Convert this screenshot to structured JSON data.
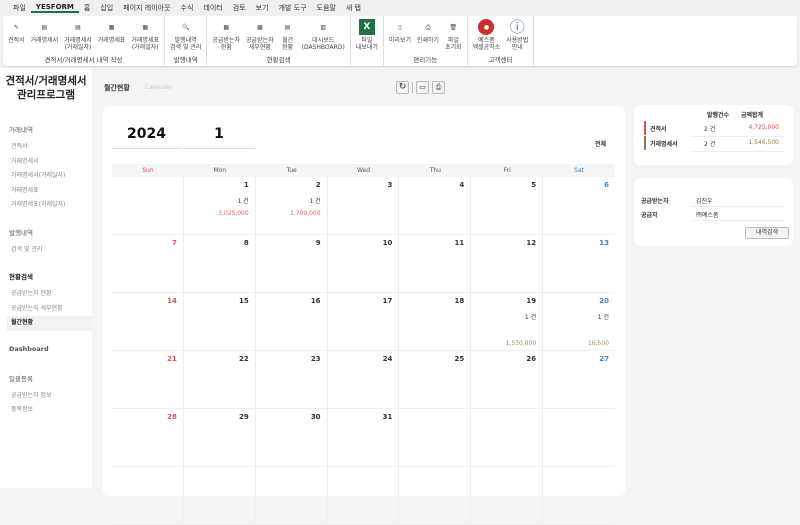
{
  "menu": [
    "파일",
    "YESFORM",
    "홈",
    "삽입",
    "페이지 레이아웃",
    "수식",
    "데이터",
    "검토",
    "보기",
    "개발 도구",
    "도움말",
    "새 탭"
  ],
  "ribbon": {
    "groups": [
      {
        "label": "견적서/거래명세서 내역 작성",
        "buttons": [
          "견적서",
          "거래명세서",
          "거래명세서\n(거래일자)",
          "거래명세표",
          "거래명세표\n(거래일자)"
        ]
      },
      {
        "label": "발행내역",
        "buttons": [
          "발행내역\n검색 및 관리"
        ]
      },
      {
        "label": "현황검색",
        "buttons": [
          "공급받는자\n현황",
          "공급받는자\n세부현황",
          "월간\n현황",
          "대시보드\n(DASHBOARD)"
        ]
      },
      {
        "label": "",
        "buttons": [
          "파일\n내보내기"
        ]
      },
      {
        "label": "편리기능",
        "buttons": [
          "미리보기",
          "인쇄하기",
          "파일\n초기화"
        ]
      },
      {
        "label": "고객센터",
        "buttons": [
          "예스폼\n엑셀공작소",
          "사용방법\n안내"
        ]
      }
    ]
  },
  "sidebar": {
    "title": "견적서/거래명세서\n관리프로그램",
    "sections": [
      {
        "label": "거래내역",
        "items": [
          "견적서",
          "거래명세서",
          "거래명세서(거래일자)",
          "거래명세표",
          "거래명세표(거래일자)"
        ]
      },
      {
        "label": "발행내역",
        "items": [
          "검색 및 관리"
        ]
      },
      {
        "label": "현황검색",
        "items": [
          "공급받는자 현황",
          "공급받는자 세부현황",
          "월간현황"
        ]
      },
      {
        "label": "Dashboard",
        "items": []
      },
      {
        "label": "일괄등록",
        "items": [
          "공급받는자 정보",
          "품목정보"
        ]
      }
    ],
    "active": "월간현황"
  },
  "page": {
    "title": "월간현황",
    "subtitle": "Calender"
  },
  "calendar": {
    "year": "2024",
    "month": "1",
    "filter": "전체",
    "weekdays": [
      "Sun",
      "Mon",
      "Tue",
      "Wed",
      "Thu",
      "Fri",
      "Sat"
    ],
    "days": [
      [
        null,
        {
          "d": "1",
          "cnt": "1 건",
          "amt": "3,025,000",
          "kind": "quote"
        },
        {
          "d": "2",
          "cnt": "1 건",
          "amt": "1,700,000",
          "kind": "quote"
        },
        {
          "d": "3"
        },
        {
          "d": "4"
        },
        {
          "d": "5"
        },
        {
          "d": "6"
        }
      ],
      [
        {
          "d": "7"
        },
        {
          "d": "8"
        },
        {
          "d": "9"
        },
        {
          "d": "10"
        },
        {
          "d": "11"
        },
        {
          "d": "12"
        },
        {
          "d": "13"
        }
      ],
      [
        {
          "d": "14"
        },
        {
          "d": "15"
        },
        {
          "d": "16"
        },
        {
          "d": "17"
        },
        {
          "d": "18"
        },
        {
          "d": "19",
          "cnt": "1 건",
          "amt": "1,530,000",
          "kind": "stmt"
        },
        {
          "d": "20",
          "cnt": "1 건",
          "amt": "16,500",
          "kind": "stmt"
        }
      ],
      [
        {
          "d": "21"
        },
        {
          "d": "22"
        },
        {
          "d": "23"
        },
        {
          "d": "24"
        },
        {
          "d": "25"
        },
        {
          "d": "26"
        },
        {
          "d": "27"
        }
      ],
      [
        {
          "d": "28"
        },
        {
          "d": "29"
        },
        {
          "d": "30"
        },
        {
          "d": "31"
        },
        null,
        null,
        null
      ],
      [
        null,
        null,
        null,
        null,
        null,
        null,
        null
      ]
    ]
  },
  "summary": {
    "headers": [
      "발행건수",
      "금액합계"
    ],
    "rows": [
      {
        "label": "견적서",
        "count": "2 건",
        "amount": "4,725,000",
        "color": "#d9534f"
      },
      {
        "label": "거래명세서",
        "count": "2 건",
        "amount": "1,546,500",
        "color": "#8a7f4e"
      }
    ]
  },
  "info": {
    "rows": [
      {
        "label": "공급받는자",
        "value": "김진우"
      },
      {
        "label": "공급자",
        "value": "㈜예스폼"
      }
    ],
    "button": "내역검색"
  },
  "colors": {
    "quote": "#e06666",
    "stmt": "#a08c5a",
    "sun": "#d9534f",
    "sat": "#3d85c6"
  }
}
